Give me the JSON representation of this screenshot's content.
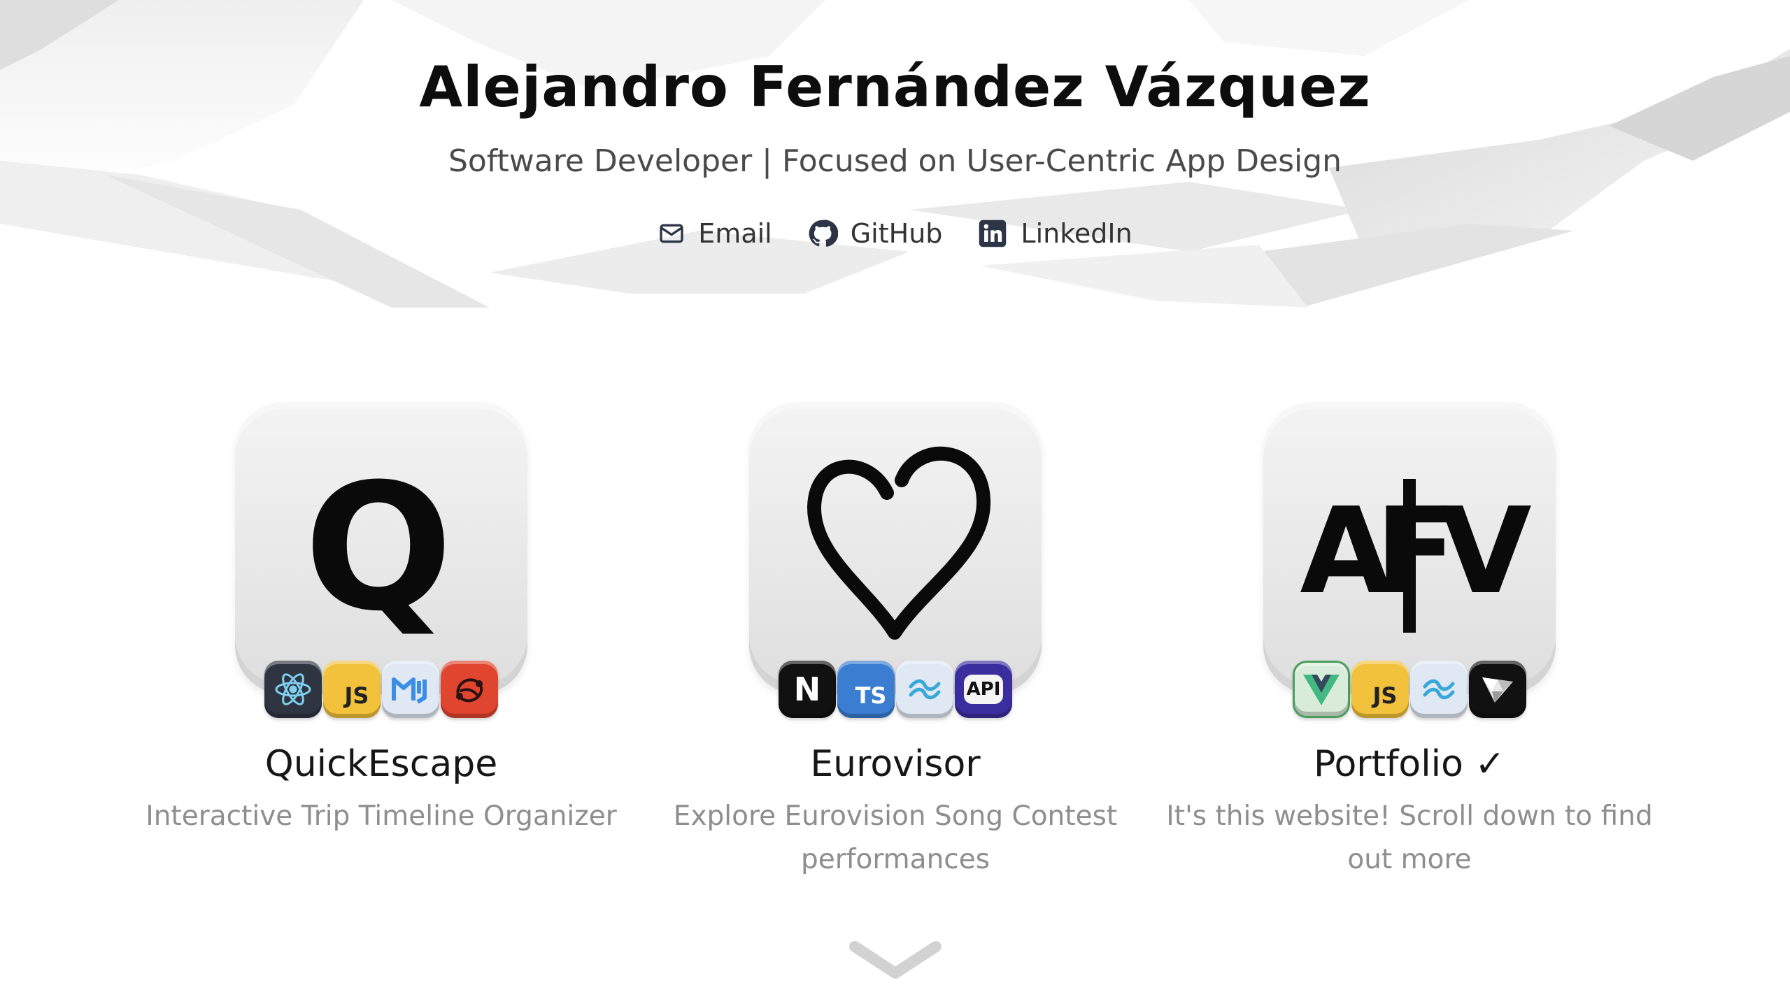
{
  "header": {
    "name": "Alejandro Fernández Vázquez",
    "subtitle": "Software Developer | Focused on User-Centric App Design",
    "contacts": [
      {
        "label": "Email",
        "icon": "mail-icon"
      },
      {
        "label": "GitHub",
        "icon": "github-icon"
      },
      {
        "label": "LinkedIn",
        "icon": "linkedin-icon"
      }
    ]
  },
  "projects": [
    {
      "title": "QuickEscape",
      "description": "Interactive Trip Timeline Organizer",
      "logo_letter": "Q",
      "tech": [
        "react-icon",
        "javascript-icon",
        "mui-icon",
        "redux-icon"
      ],
      "tech_text": {
        "js": "JS"
      }
    },
    {
      "title": "Eurovisor",
      "description": "Explore Eurovision Song Contest performances",
      "logo_icon": "heart-icon",
      "tech": [
        "nextjs-icon",
        "typescript-icon",
        "tailwind-icon",
        "api-icon"
      ],
      "tech_text": {
        "next": "N",
        "ts": "TS",
        "api": "API"
      }
    },
    {
      "title": "Portfolio ✓",
      "description": "It's this website! Scroll down to find out more",
      "logo_text": "AFV",
      "tech": [
        "vue-icon",
        "javascript-icon",
        "tailwind-icon",
        "vite-icon"
      ],
      "tech_text": {
        "js": "JS"
      }
    }
  ],
  "colors": {
    "title": "#0d0d0d",
    "subtitle": "#4a4a4a",
    "description": "#8e8e8e",
    "react_bg": "#2e3440",
    "js_bg": "#f2c23c",
    "mui_bg": "#dfe8f3",
    "redux_bg": "#e0452f",
    "next_bg": "#111111",
    "ts_bg": "#3b7dd1",
    "tailwind_bg": "#dfe8f3",
    "api_bg": "#3a2d9e",
    "vue_bg": "#d9ecd9",
    "vite_bg": "#111111"
  },
  "scroll_icon": "chevron-down-icon"
}
